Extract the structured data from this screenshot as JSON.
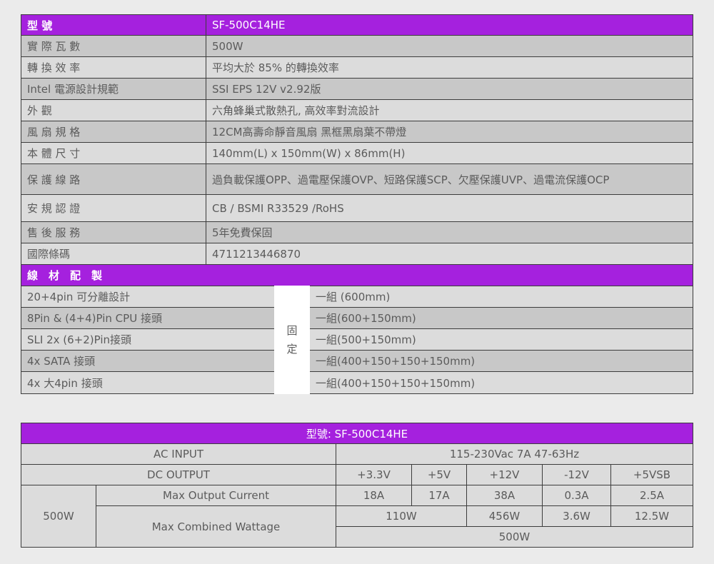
{
  "spec_table": {
    "header": {
      "label": "型 號",
      "value": "SF-500C14HE"
    },
    "rows": [
      {
        "label": "實 際 瓦 數",
        "value": "500W"
      },
      {
        "label": "轉 換 效 率",
        "value": "平均大於 85% 的轉換效率"
      },
      {
        "label": "Intel 電源設計規範",
        "value": "SSI EPS 12V v2.92版"
      },
      {
        "label": "外 觀",
        "value": "六角蜂巢式散熱孔, 高效率對流設計"
      },
      {
        "label": "風 扇 規 格",
        "value": "12CM高壽命靜音風扇 黑框黑扇葉不帶燈"
      },
      {
        "label": "本 體 尺 寸",
        "value": "140mm(L) x 150mm(W) x 86mm(H)"
      },
      {
        "label": "保 護 線 路",
        "value": "過負載保護OPP、過電壓保護OVP、短路保護SCP、欠壓保護UVP、過電流保護OCP"
      },
      {
        "label": "安 規 認 證",
        "value": "CB / BSMI R33529 /RoHS"
      },
      {
        "label": "售 後 服 務",
        "value": "5年免費保固"
      },
      {
        "label": "國際條碼",
        "value": "4711213446870"
      }
    ]
  },
  "cable_section": {
    "title": "線　材　配　製",
    "fixed_label_1": "固",
    "fixed_label_2": "定",
    "rows": [
      {
        "connector": "20+4pin 可分離設計",
        "spec": "一組 (600mm)"
      },
      {
        "connector": "8Pin & (4+4)Pin CPU 接頭",
        "spec": "一組(600+150mm)"
      },
      {
        "connector": "SLI 2x (6+2)Pin接頭",
        "spec": "一組(500+150mm)"
      },
      {
        "connector": "4x SATA 接頭",
        "spec": "一組(400+150+150+150mm)"
      },
      {
        "connector": "4x 大4pin 接頭",
        "spec": "一組(400+150+150+150mm)"
      }
    ]
  },
  "power_table": {
    "title": "型號: SF-500C14HE",
    "ac_input_label": "AC INPUT",
    "ac_input_value": "115-230Vac 7A 47-63Hz",
    "dc_output_label": "DC OUTPUT",
    "rails": [
      "+3.3V",
      "+5V",
      "+12V",
      "-12V",
      "+5VSB"
    ],
    "total_label": "500W",
    "max_current_label": "Max Output Current",
    "max_current": [
      "18A",
      "17A",
      "38A",
      "0.3A",
      "2.5A"
    ],
    "combined_label": "Max Combined Wattage",
    "combined_3v3_5v": "110W",
    "combined_12v": "456W",
    "combined_neg12v": "3.6W",
    "combined_5vsb": "12.5W",
    "combined_total": "500W"
  }
}
